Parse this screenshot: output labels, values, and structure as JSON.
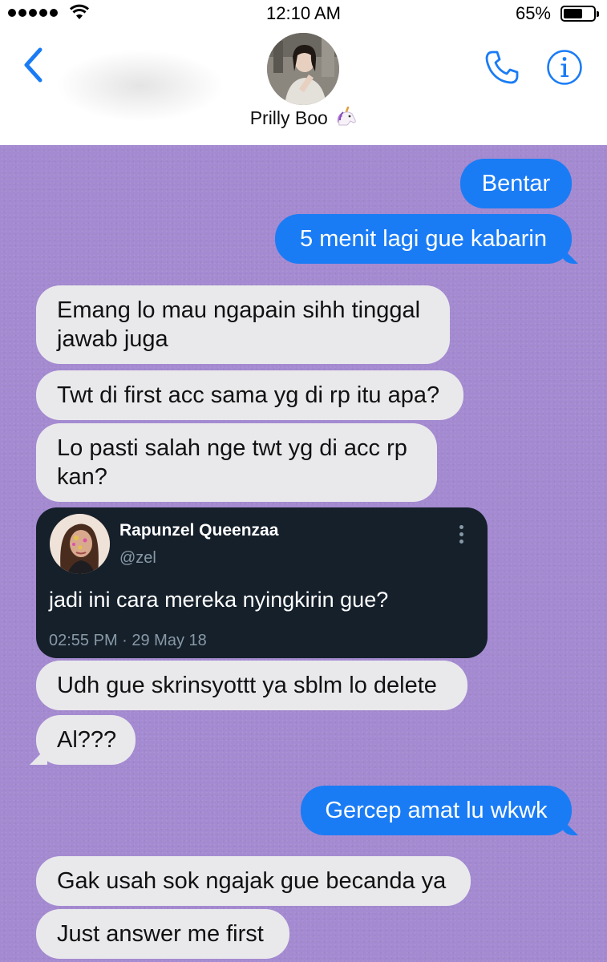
{
  "status_bar": {
    "time": "12:10 AM",
    "battery_percent_label": "65%",
    "battery_level": 0.65
  },
  "header": {
    "contact_name": "Prilly Boo",
    "contact_emoji": "unicorn-icon",
    "accent_color": "#1a7cf5"
  },
  "messages": [
    {
      "id": "m1",
      "direction": "outgoing",
      "text": "Bentar"
    },
    {
      "id": "m2",
      "direction": "outgoing",
      "text": "5 menit lagi gue kabarin"
    },
    {
      "id": "m3",
      "direction": "incoming",
      "text": "Emang lo mau ngapain sihh tinggal jawab juga"
    },
    {
      "id": "m4",
      "direction": "incoming",
      "text": "Twt di first acc sama yg di rp itu apa?"
    },
    {
      "id": "m5",
      "direction": "incoming",
      "text": "Lo pasti salah nge twt yg di acc rp kan?"
    },
    {
      "id": "m6",
      "direction": "incoming",
      "text": "Udh gue skrinsyottt ya sblm lo delete"
    },
    {
      "id": "m7",
      "direction": "incoming",
      "text": "Al???"
    },
    {
      "id": "m8",
      "direction": "outgoing",
      "text": "Gercep amat lu wkwk"
    },
    {
      "id": "m9",
      "direction": "incoming",
      "text": "Gak usah sok ngajak gue becanda ya"
    },
    {
      "id": "m10",
      "direction": "incoming",
      "text": "Just answer me first"
    }
  ],
  "tweet": {
    "display_name": "Rapunzel Queenzaa",
    "handle": "@zel",
    "text": "jadi ini cara mereka nyingkirin gue?",
    "timestamp": "02:55 PM · 29 May 18"
  },
  "colors": {
    "chat_background": "#a48ad0",
    "outgoing_bubble": "#1a7cf5",
    "incoming_bubble": "#e9e9ec",
    "tweet_background": "#15202b"
  }
}
